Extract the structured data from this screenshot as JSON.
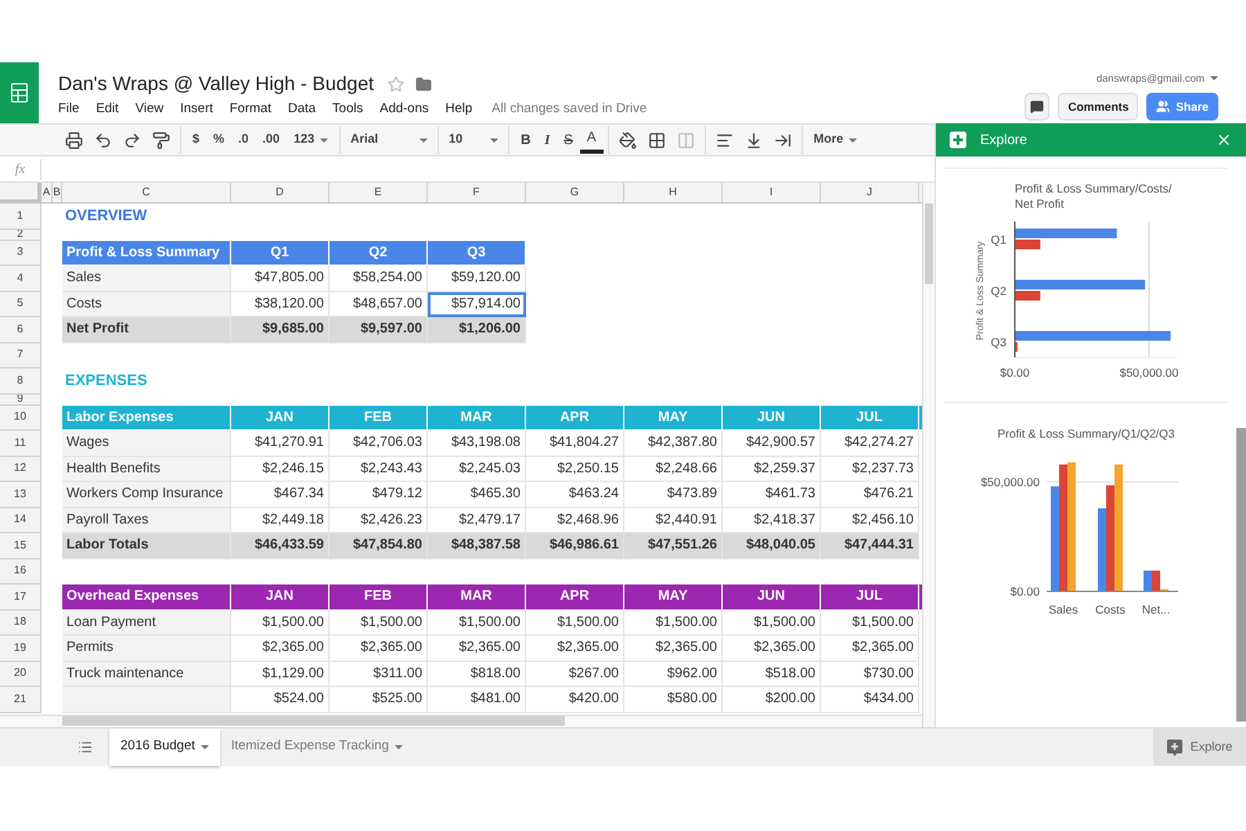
{
  "document": {
    "title": "Dan's Wraps @ Valley High - Budget",
    "starred": false,
    "save_status": "All changes saved in Drive"
  },
  "menu": [
    "File",
    "Edit",
    "View",
    "Insert",
    "Format",
    "Data",
    "Tools",
    "Add-ons",
    "Help"
  ],
  "account": {
    "email": "danswraps@gmail.com"
  },
  "header_buttons": {
    "comments": "Comments",
    "share": "Share"
  },
  "toolbar": [
    [
      {
        "kind": "print"
      },
      {
        "kind": "undo"
      },
      {
        "kind": "redo"
      },
      {
        "kind": "paint-format"
      }
    ],
    [
      {
        "kind": "text",
        "text": "$"
      },
      {
        "kind": "text",
        "text": "%"
      },
      {
        "kind": "text",
        "text": ".0"
      },
      {
        "kind": "text",
        "text": ".00"
      },
      {
        "kind": "dropdown",
        "text": "123"
      }
    ],
    [
      {
        "kind": "font",
        "text": "Arial"
      }
    ],
    [
      {
        "kind": "size",
        "text": "10"
      }
    ],
    [
      {
        "kind": "bold",
        "text": "B"
      },
      {
        "kind": "italic",
        "text": "I"
      },
      {
        "kind": "strike",
        "text": "S"
      },
      {
        "kind": "text-color",
        "text": "A"
      }
    ],
    [
      {
        "kind": "fill"
      },
      {
        "kind": "borders"
      },
      {
        "kind": "merge"
      }
    ],
    [
      {
        "kind": "align"
      },
      {
        "kind": "valign"
      },
      {
        "kind": "wrap"
      }
    ],
    [
      {
        "kind": "dropdown",
        "text": "More"
      }
    ]
  ],
  "formula_bar": {
    "label": "fx"
  },
  "sheet": {
    "columns": [
      "A",
      "B",
      "C",
      "D",
      "E",
      "F",
      "G",
      "H",
      "I",
      "J"
    ],
    "rows": [
      {
        "number": "1",
        "kind": "title",
        "text": "OVERVIEW",
        "color": "#3c78d8"
      },
      {
        "number": "2",
        "kind": "thin"
      },
      {
        "number": "3",
        "kind": "header",
        "color": "#4a86e8",
        "label": "Profit & Loss Summary",
        "values": [
          "Q1",
          "Q2",
          "Q3"
        ]
      },
      {
        "number": "4",
        "kind": "data",
        "label": "Sales",
        "values": [
          "$47,805.00",
          "$58,254.00",
          "$59,120.00"
        ]
      },
      {
        "number": "5",
        "kind": "data",
        "label": "Costs",
        "values": [
          {
            "text": "$38,120.00",
            "selected": false
          },
          {
            "text": "$48,657.00",
            "selected": false
          },
          {
            "text": "$57,914.00",
            "selected": true
          }
        ]
      },
      {
        "number": "6",
        "kind": "total",
        "label": "Net Profit",
        "values": [
          "$9,685.00",
          "$9,597.00",
          "$1,206.00"
        ]
      },
      {
        "number": "7",
        "kind": "blank"
      },
      {
        "number": "8",
        "kind": "title",
        "text": "EXPENSES",
        "color": "#1fb3d1"
      },
      {
        "number": "9",
        "kind": "thin"
      },
      {
        "number": "10",
        "kind": "header",
        "color": "#1fb3d1",
        "label": "Labor Expenses",
        "values": [
          "JAN",
          "FEB",
          "MAR",
          "APR",
          "MAY",
          "JUN",
          "JUL"
        ]
      },
      {
        "number": "11",
        "kind": "data",
        "label": "Wages",
        "values": [
          "$41,270.91",
          "$42,706.03",
          "$43,198.08",
          "$41,804.27",
          "$42,387.80",
          "$42,900.57",
          "$42,274.27"
        ]
      },
      {
        "number": "12",
        "kind": "data",
        "label": "Health Benefits",
        "values": [
          "$2,246.15",
          "$2,243.43",
          "$2,245.03",
          "$2,250.15",
          "$2,248.66",
          "$2,259.37",
          "$2,237.73"
        ]
      },
      {
        "number": "13",
        "kind": "data",
        "label": "Workers Comp Insurance",
        "values": [
          "$467.34",
          "$479.12",
          "$465.30",
          "$463.24",
          "$473.89",
          "$461.73",
          "$476.21"
        ]
      },
      {
        "number": "14",
        "kind": "data",
        "label": "Payroll Taxes",
        "values": [
          "$2,449.18",
          "$2,426.23",
          "$2,479.17",
          "$2,468.96",
          "$2,440.91",
          "$2,418.37",
          "$2,456.10"
        ]
      },
      {
        "number": "15",
        "kind": "total",
        "label": "Labor Totals",
        "values": [
          "$46,433.59",
          "$47,854.80",
          "$48,387.58",
          "$46,986.61",
          "$47,551.26",
          "$48,040.05",
          "$47,444.31"
        ]
      },
      {
        "number": "16",
        "kind": "blank"
      },
      {
        "number": "17",
        "kind": "header",
        "color": "#9c27b0",
        "label": "Overhead Expenses",
        "values": [
          "JAN",
          "FEB",
          "MAR",
          "APR",
          "MAY",
          "JUN",
          "JUL"
        ]
      },
      {
        "number": "18",
        "kind": "data",
        "label": "Loan Payment",
        "values": [
          "$1,500.00",
          "$1,500.00",
          "$1,500.00",
          "$1,500.00",
          "$1,500.00",
          "$1,500.00",
          "$1,500.00"
        ]
      },
      {
        "number": "19",
        "kind": "data",
        "label": "Permits",
        "values": [
          "$2,365.00",
          "$2,365.00",
          "$2,365.00",
          "$2,365.00",
          "$2,365.00",
          "$2,365.00",
          "$2,365.00"
        ]
      },
      {
        "number": "20",
        "kind": "data",
        "label": "Truck maintenance",
        "values": [
          "$1,129.00",
          "$311.00",
          "$818.00",
          "$267.00",
          "$962.00",
          "$518.00",
          "$730.00"
        ]
      },
      {
        "number": "21",
        "kind": "data",
        "values": [
          "$524.00",
          "$525.00",
          "$481.00",
          "$420.00",
          "$580.00",
          "$200.00",
          "$434.00"
        ]
      }
    ]
  },
  "sheet_tabs": [
    {
      "label": "2016 Budget",
      "selected": true
    },
    {
      "label": "Itemized Expense Tracking",
      "selected": false
    }
  ],
  "explore": {
    "title": "Explore",
    "button": "Explore",
    "charts": [
      {
        "chart_data": {
          "type": "bar",
          "orientation": "horizontal",
          "title": "Profit & Loss Summary/Costs/Net Profit",
          "ylabel": "Profit & Loss Summary",
          "categories": [
            "Q1",
            "Q2",
            "Q3"
          ],
          "series": [
            {
              "color": "#4a86e8",
              "values": [
                38000,
                48500,
                58000
              ]
            },
            {
              "color": "#db4437",
              "values": [
                9500,
                9500,
                1000
              ]
            }
          ],
          "xlim": [
            0,
            60000
          ],
          "xticks": [
            {
              "value": 0,
              "label": "$0.00"
            },
            {
              "value": 50000,
              "label": "$50,000.00"
            }
          ]
        }
      },
      {
        "chart_data": {
          "type": "bar",
          "title": "Profit & Loss Summary/Q1/Q2/Q3",
          "categories": [
            "Sales",
            "Costs",
            "Net..."
          ],
          "series": [
            {
              "color": "#4a86e8",
              "values": [
                48000,
                38000,
                9500
              ]
            },
            {
              "color": "#db4437",
              "values": [
                58000,
                48500,
                9500
              ]
            },
            {
              "color": "#f4a52e",
              "values": [
                59000,
                58000,
                1000
              ]
            }
          ],
          "ylim": [
            0,
            60000
          ],
          "yticks": [
            {
              "value": 0,
              "label": "$0.00"
            },
            {
              "value": 50000,
              "label": "$50,000.00"
            }
          ]
        }
      }
    ]
  }
}
